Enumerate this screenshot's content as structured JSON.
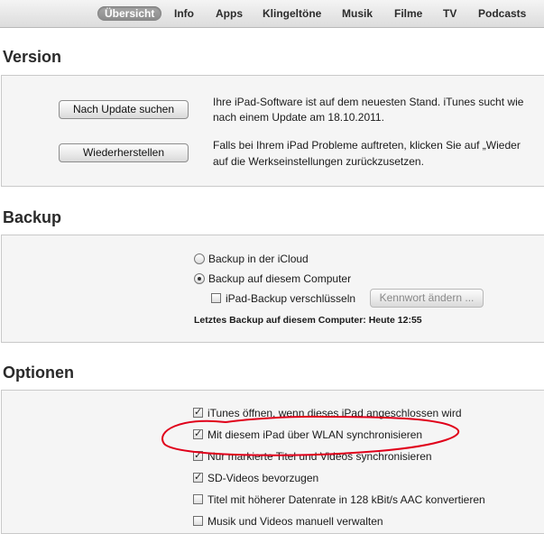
{
  "tabs": [
    "Übersicht",
    "Info",
    "Apps",
    "Klingeltöne",
    "Musik",
    "Filme",
    "TV",
    "Podcasts"
  ],
  "selected_tab": "Übersicht",
  "version": {
    "title": "Version",
    "update_button": "Nach Update suchen",
    "restore_button": "Wiederherstellen",
    "update_text_1": "Ihre iPad-Software ist auf dem neuesten Stand. iTunes sucht wie",
    "update_text_2": "nach einem Update am 18.10.2011.",
    "restore_text_1": "Falls bei Ihrem iPad Probleme auftreten, klicken Sie auf „Wieder",
    "restore_text_2": "auf die Werkseinstellungen zurückzusetzen."
  },
  "backup": {
    "title": "Backup",
    "radio_icloud": "Backup in der iCloud",
    "radio_computer": "Backup auf diesem Computer",
    "selected": "computer",
    "encrypt_label": "iPad-Backup verschlüsseln",
    "encrypt_checked": false,
    "change_password_button": "Kennwort ändern ...",
    "last_backup": "Letztes Backup auf diesem Computer: Heute 12:55"
  },
  "options": {
    "title": "Optionen",
    "items": [
      {
        "label": "iTunes öffnen, wenn dieses iPad angeschlossen wird",
        "checked": true
      },
      {
        "label": "Mit diesem iPad über WLAN synchronisieren",
        "checked": true
      },
      {
        "label": "Nur markierte Titel und Videos synchronisieren",
        "checked": true
      },
      {
        "label": "SD-Videos bevorzugen",
        "checked": true
      },
      {
        "label": "Titel mit höherer Datenrate in 128 kBit/s AAC konvertieren",
        "checked": false
      },
      {
        "label": "Musik und Videos manuell verwalten",
        "checked": false
      }
    ]
  },
  "annotation_color": "#e0001a"
}
